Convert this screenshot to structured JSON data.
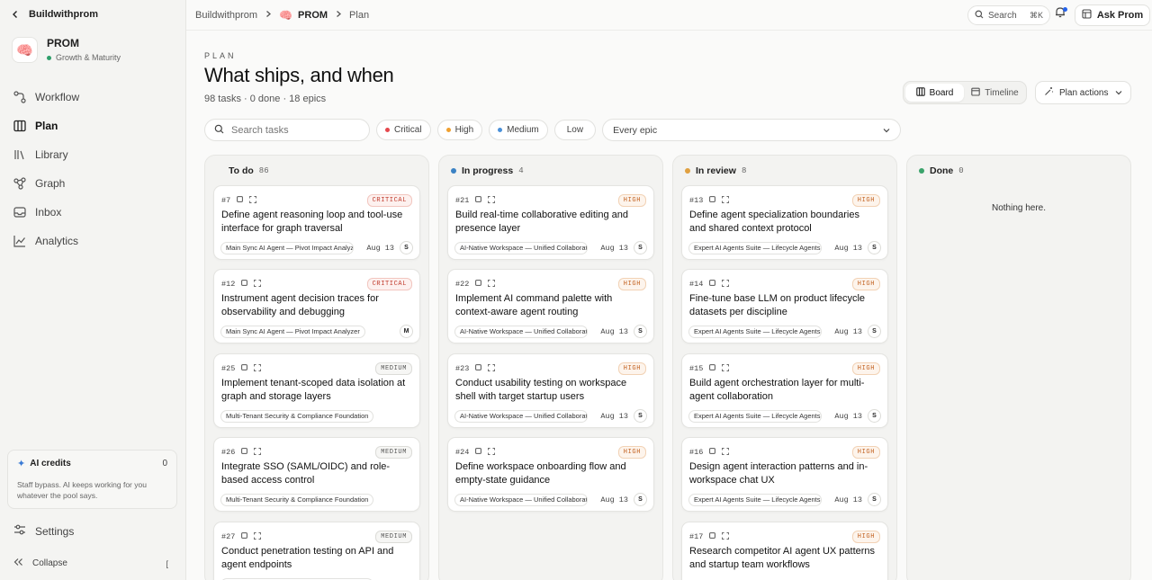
{
  "sidebar": {
    "back_label": "Buildwithprom",
    "workspace": {
      "name": "PROM",
      "status": "Growth & Maturity",
      "logo": "🧠"
    },
    "nav": [
      {
        "label": "Workflow",
        "icon": "workflow-icon",
        "active": false
      },
      {
        "label": "Plan",
        "icon": "plan-icon",
        "active": true
      },
      {
        "label": "Library",
        "icon": "library-icon",
        "active": false
      },
      {
        "label": "Graph",
        "icon": "graph-icon",
        "active": false
      },
      {
        "label": "Inbox",
        "icon": "inbox-icon",
        "active": false
      },
      {
        "label": "Analytics",
        "icon": "analytics-icon",
        "active": false
      }
    ],
    "credits": {
      "title": "AI credits",
      "value": "0",
      "description": "Staff bypass. AI keeps working for you whatever the pool says."
    },
    "settings_label": "Settings",
    "collapse_label": "Collapse",
    "collapse_shortcut": "["
  },
  "header": {
    "breadcrumb": [
      "Buildwithprom",
      "PROM",
      "Plan"
    ],
    "brain_icon": "🧠",
    "search_label": "Search",
    "search_shortcut": "⌘K",
    "ask_label": "Ask Prom"
  },
  "page": {
    "eyebrow": "PLAN",
    "title": "What ships, and when",
    "meta": "98 tasks · 0 done · 18 epics",
    "views": [
      "Board",
      "Timeline"
    ],
    "active_view": "Board",
    "plan_actions_label": "Plan actions"
  },
  "filters": {
    "search_placeholder": "Search tasks",
    "priorities": [
      {
        "label": "Critical",
        "color": "#e5484d"
      },
      {
        "label": "High",
        "color": "#f0a030"
      },
      {
        "label": "Medium",
        "color": "#4a90d9"
      },
      {
        "label": "Low",
        "color": ""
      }
    ],
    "epic_selected": "Every epic"
  },
  "columns": [
    {
      "title": "To do",
      "count": "86",
      "dot": "",
      "cards": [
        {
          "id": "#7",
          "priority": "CRITICAL",
          "title": "Define agent reasoning loop and tool-use interface for graph traversal",
          "epic": "Main Sync AI Agent — Pivot Impact Analyzer",
          "due": "Aug 13",
          "assignee": "S"
        },
        {
          "id": "#12",
          "priority": "CRITICAL",
          "title": "Instrument agent decision traces for observability and debugging",
          "epic": "Main Sync AI Agent — Pivot Impact Analyzer",
          "due": "",
          "assignee": "M"
        },
        {
          "id": "#25",
          "priority": "MEDIUM",
          "title": "Implement tenant-scoped data isolation at graph and storage layers",
          "epic": "Multi-Tenant Security & Compliance Foundation",
          "due": "",
          "assignee": ""
        },
        {
          "id": "#26",
          "priority": "MEDIUM",
          "title": "Integrate SSO (SAML/OIDC) and role-based access control",
          "epic": "Multi-Tenant Security & Compliance Foundation",
          "due": "",
          "assignee": ""
        },
        {
          "id": "#27",
          "priority": "MEDIUM",
          "title": "Conduct penetration testing on API and agent endpoints",
          "epic": "Multi-Tenant Security & Compliance Foundation",
          "due": "",
          "assignee": ""
        }
      ]
    },
    {
      "title": "In progress",
      "count": "4",
      "dot": "#3b82c4",
      "cards": [
        {
          "id": "#21",
          "priority": "HIGH",
          "title": "Build real-time collaborative editing and presence layer",
          "epic": "AI-Native Workspace — Unified Collaboration",
          "due": "Aug 13",
          "assignee": "S"
        },
        {
          "id": "#22",
          "priority": "HIGH",
          "title": "Implement AI command palette with context-aware agent routing",
          "epic": "AI-Native Workspace — Unified Collaboration",
          "due": "Aug 13",
          "assignee": "S"
        },
        {
          "id": "#23",
          "priority": "HIGH",
          "title": "Conduct usability testing on workspace shell with target startup users",
          "epic": "AI-Native Workspace — Unified Collaboration",
          "due": "Aug 13",
          "assignee": "S"
        },
        {
          "id": "#24",
          "priority": "HIGH",
          "title": "Define workspace onboarding flow and empty-state guidance",
          "epic": "AI-Native Workspace — Unified Collaboration",
          "due": "Aug 13",
          "assignee": "S"
        }
      ]
    },
    {
      "title": "In review",
      "count": "8",
      "dot": "#e0a040",
      "cards": [
        {
          "id": "#13",
          "priority": "HIGH",
          "title": "Define agent specialization boundaries and shared context protocol",
          "epic": "Expert AI Agents Suite — Lifecycle Agents",
          "due": "Aug 13",
          "assignee": "S"
        },
        {
          "id": "#14",
          "priority": "HIGH",
          "title": "Fine-tune base LLM on product lifecycle datasets per discipline",
          "epic": "Expert AI Agents Suite — Lifecycle Agents",
          "due": "Aug 13",
          "assignee": "S"
        },
        {
          "id": "#15",
          "priority": "HIGH",
          "title": "Build agent orchestration layer for multi-agent collaboration",
          "epic": "Expert AI Agents Suite — Lifecycle Agents",
          "due": "Aug 13",
          "assignee": "S"
        },
        {
          "id": "#16",
          "priority": "HIGH",
          "title": "Design agent interaction patterns and in-workspace chat UX",
          "epic": "Expert AI Agents Suite — Lifecycle Agents",
          "due": "Aug 13",
          "assignee": "S"
        },
        {
          "id": "#17",
          "priority": "HIGH",
          "title": "Research competitor AI agent UX patterns and startup team workflows",
          "epic": "",
          "due": "",
          "assignee": ""
        }
      ]
    },
    {
      "title": "Done",
      "count": "0",
      "dot": "#3aa36b",
      "empty_text": "Nothing here.",
      "cards": []
    }
  ]
}
